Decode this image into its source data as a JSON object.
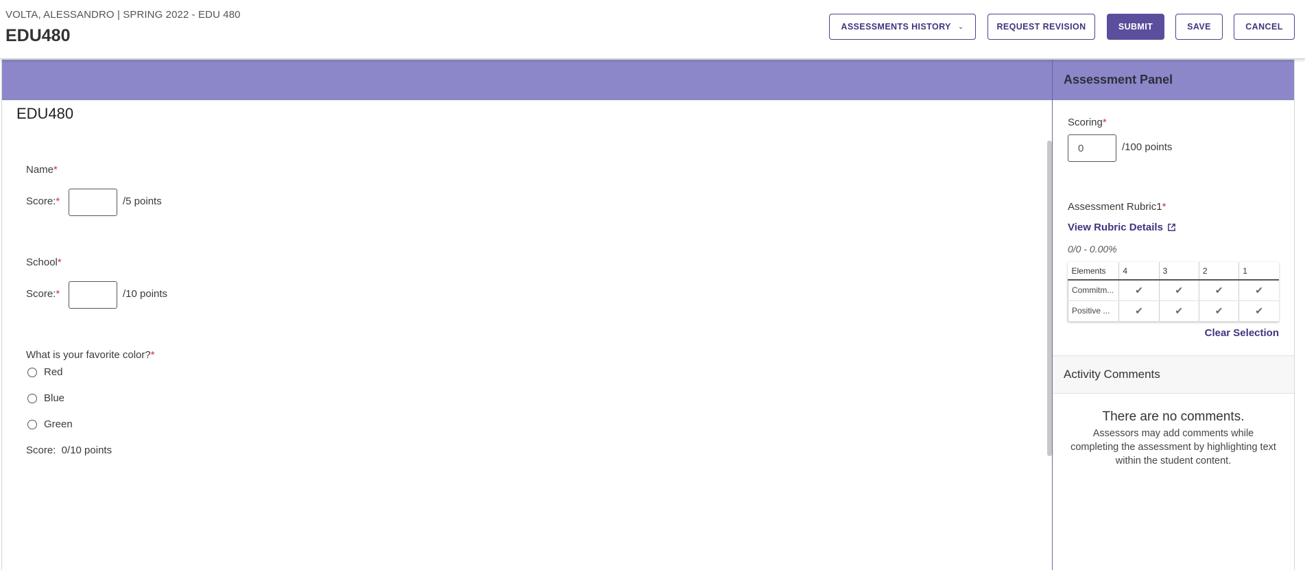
{
  "header": {
    "breadcrumb_student": "VOLTA, ALESSANDRO",
    "breadcrumb_separator": "|",
    "breadcrumb_course": "SPRING 2022 - EDU 480",
    "title": "EDU480",
    "buttons": {
      "history": "ASSESSMENTS HISTORY",
      "request_revision": "REQUEST REVISION",
      "submit": "SUBMIT",
      "save": "SAVE",
      "cancel": "CANCEL"
    }
  },
  "main": {
    "title": "EDU480",
    "required_mark": "*",
    "questions": [
      {
        "label": "Name",
        "score_label": "Score:",
        "score_value": "",
        "points": "/5 points"
      },
      {
        "label": "School",
        "score_label": "Score:",
        "score_value": "",
        "points": "/10 points"
      }
    ],
    "choice_question": {
      "label": "What is your favorite color?",
      "options": [
        "Red",
        "Blue",
        "Green"
      ],
      "score_text": "Score:  0/10 points"
    }
  },
  "panel": {
    "title": "Assessment Panel",
    "scoring_label": "Scoring",
    "scoring_value": "0",
    "scoring_points": "/100 points",
    "rubric_label": "Assessment Rubric1",
    "rubric_link": "View Rubric Details",
    "rubric_percent": "0/0 - 0.00%",
    "rubric_headers": [
      "Elements",
      "4",
      "3",
      "2",
      "1"
    ],
    "rubric_rows": [
      "Commitm...",
      "Positive ..."
    ],
    "check_glyph": "✔",
    "clear_selection": "Clear Selection",
    "comments_title": "Activity Comments",
    "no_comments": "There are no comments.",
    "no_comments_desc": "Assessors may add comments while completing the assessment by highlighting text within the student content."
  },
  "colors": {
    "accent": "#5b4e9c",
    "band": "#8b87c8",
    "required": "#d0313a"
  }
}
